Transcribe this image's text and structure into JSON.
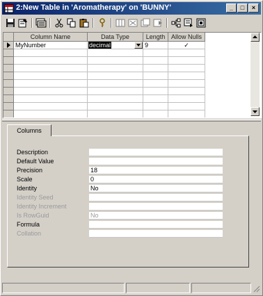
{
  "window": {
    "title": "2:New Table in 'Aromatherapy' on 'BUNNY'",
    "minimize_glyph": "_",
    "maximize_glyph": "□",
    "close_glyph": "×"
  },
  "toolbar": {
    "icons": [
      "save-icon",
      "properties-icon",
      "generate-script-icon",
      "cut-icon",
      "copy-icon",
      "paste-icon",
      "set-primary-key-icon",
      "insert-column-icon",
      "delete-column-icon",
      "manage-indexes-icon",
      "manage-relationships-icon",
      "manage-constraints-icon",
      "table-properties-icon"
    ]
  },
  "grid": {
    "columns": [
      "Column Name",
      "Data Type",
      "Length",
      "Allow Nulls"
    ],
    "rows": [
      {
        "column_name": "MyNumber",
        "data_type": "decimal",
        "length": "9",
        "allow_nulls": "✓"
      }
    ]
  },
  "tabs": {
    "active": "Columns"
  },
  "properties": [
    {
      "label": "Description",
      "value": "",
      "enabled": true
    },
    {
      "label": "Default Value",
      "value": "",
      "enabled": true
    },
    {
      "label": "Precision",
      "value": "18",
      "enabled": true
    },
    {
      "label": "Scale",
      "value": "0",
      "enabled": true
    },
    {
      "label": "Identity",
      "value": "No",
      "enabled": true
    },
    {
      "label": "Identity Seed",
      "value": "",
      "enabled": false
    },
    {
      "label": "Identity Increment",
      "value": "",
      "enabled": false
    },
    {
      "label": "Is RowGuid",
      "value": "No",
      "enabled": false
    },
    {
      "label": "Formula",
      "value": "",
      "enabled": true
    },
    {
      "label": "Collation",
      "value": "",
      "enabled": false
    }
  ]
}
